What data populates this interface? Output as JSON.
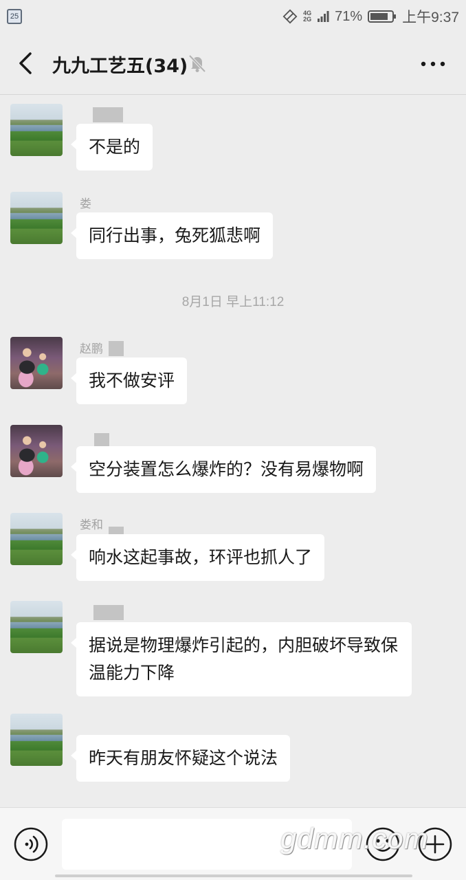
{
  "status_bar": {
    "calendar_day": "25",
    "network_top": "4G",
    "network_bottom": "2G",
    "battery_percent": "71%",
    "time": "上午9:37",
    "icons": [
      "calendar-icon",
      "rotate-lock-icon",
      "signal-icon",
      "battery-icon"
    ]
  },
  "header": {
    "title": "九九工艺五(34)",
    "back_icon": "chevron-left-icon",
    "mute_icon": "bell-off-icon",
    "more_icon": "more-dots-icon"
  },
  "messages": [
    {
      "sender": "",
      "text": "不是的",
      "avatar": "landscape"
    },
    {
      "sender": "娄",
      "text": "同行出事，兔死狐悲啊",
      "avatar": "landscape"
    },
    {
      "sender": "赵鹏",
      "text": "我不做安评",
      "avatar": "kids"
    },
    {
      "sender": "",
      "text": "空分装置怎么爆炸的？没有易爆物啊",
      "avatar": "kids"
    },
    {
      "sender": "娄和",
      "text": "响水这起事故，环评也抓人了",
      "avatar": "landscape"
    },
    {
      "sender": "",
      "text": "据说是物理爆炸引起的，内胆破坏导致保温能力下降",
      "avatar": "landscape"
    },
    {
      "sender": "",
      "text": "昨天有朋友怀疑这个说法",
      "avatar": "landscape"
    }
  ],
  "time_divider": "8月1日 早上11:12",
  "input_bar": {
    "placeholder": "",
    "voice_icon": "voice-icon",
    "emoji_icon": "emoji-icon",
    "plus_icon": "plus-icon"
  },
  "watermark": "gdmm.com",
  "colors": {
    "background": "#ededed",
    "bubble": "#ffffff",
    "text": "#191919",
    "meta_text": "#a7a7a7"
  }
}
